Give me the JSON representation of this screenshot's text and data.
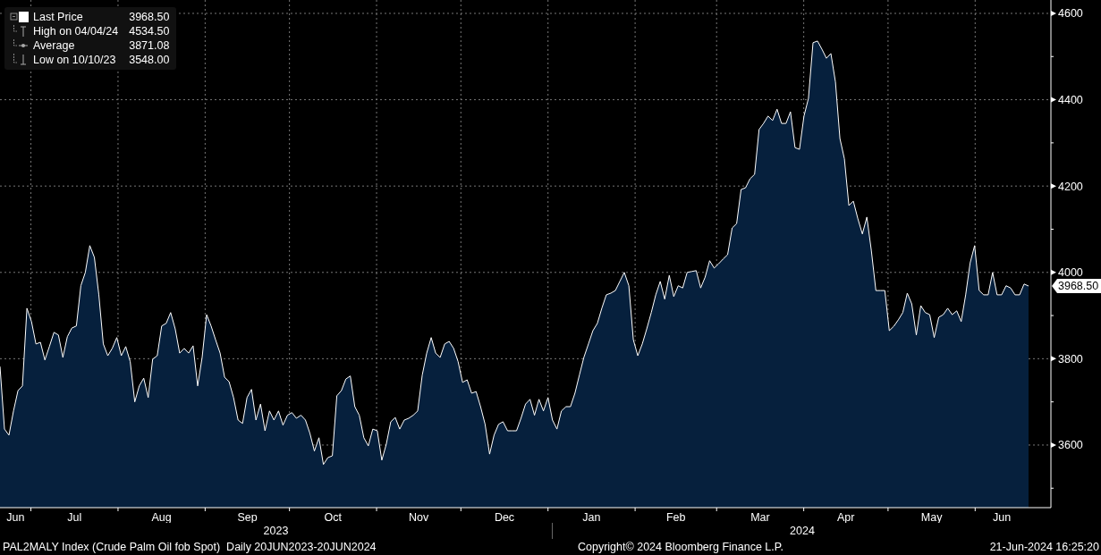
{
  "legend": {
    "items": [
      {
        "kind": "last",
        "label": "Last Price",
        "value": "3968.50"
      },
      {
        "kind": "high",
        "label": "High on 04/04/24",
        "value": "4534.50"
      },
      {
        "kind": "average",
        "label": "Average",
        "value": "3871.08"
      },
      {
        "kind": "low",
        "label": "Low on 10/10/23",
        "value": "3548.00"
      }
    ]
  },
  "chart": {
    "month_labels": [
      "Jun",
      "Jul",
      "Aug",
      "Sep",
      "Oct",
      "Nov",
      "Dec",
      "Jan",
      "Feb",
      "Mar",
      "Apr",
      "May",
      "Jun"
    ],
    "chart_data": {
      "type": "area",
      "grid": true,
      "ylim": [
        3455,
        4631
      ],
      "yticks": [
        3600,
        3800,
        4000,
        4200,
        4400,
        4600
      ],
      "series": [
        {
          "color": "#ffffff",
          "values": [
            3782,
            3637,
            3623,
            3679,
            3726,
            3737,
            3917,
            3886,
            3834,
            3838,
            3797,
            3828,
            3861,
            3855,
            3803,
            3851,
            3871,
            3876,
            3969,
            4000,
            4062,
            4035,
            3948,
            3834,
            3807,
            3824,
            3849,
            3807,
            3828,
            3793,
            3700,
            3737,
            3755,
            3710,
            3799,
            3807,
            3876,
            3882,
            3907,
            3869,
            3813,
            3824,
            3813,
            3830,
            3737,
            3803,
            3902,
            3876,
            3844,
            3813,
            3757,
            3747,
            3710,
            3658,
            3650,
            3710,
            3729,
            3658,
            3695,
            3633,
            3679,
            3658,
            3679,
            3646,
            3669,
            3675,
            3662,
            3669,
            3658,
            3627,
            3586,
            3617,
            3555,
            3571,
            3575,
            3714,
            3726,
            3753,
            3760,
            3689,
            3669,
            3617,
            3598,
            3637,
            3633,
            3565,
            3602,
            3654,
            3664,
            3637,
            3658,
            3662,
            3669,
            3679,
            3762,
            3813,
            3849,
            3813,
            3803,
            3834,
            3840,
            3824,
            3793,
            3745,
            3751,
            3720,
            3724,
            3689,
            3648,
            3579,
            3623,
            3648,
            3654,
            3633,
            3633,
            3633,
            3662,
            3695,
            3706,
            3669,
            3706,
            3679,
            3710,
            3658,
            3637,
            3679,
            3689,
            3689,
            3720,
            3762,
            3803,
            3834,
            3865,
            3882,
            3917,
            3948,
            3952,
            3958,
            3979,
            4000,
            3969,
            3844,
            3807,
            3834,
            3869,
            3907,
            3948,
            3979,
            3938,
            3993,
            3944,
            3969,
            3964,
            4000,
            4002,
            4004,
            3964,
            3989,
            4027,
            4010,
            4020,
            4031,
            4041,
            4103,
            4113,
            4192,
            4196,
            4217,
            4227,
            4331,
            4345,
            4362,
            4352,
            4378,
            4345,
            4345,
            4372,
            4289,
            4285,
            4362,
            4403,
            4532,
            4536,
            4517,
            4496,
            4507,
            4441,
            4310,
            4263,
            4155,
            4165,
            4124,
            4089,
            4128,
            4051,
            3958,
            3958,
            3958,
            3865,
            3875,
            3890,
            3907,
            3952,
            3927,
            3855,
            3923,
            3907,
            3902,
            3849,
            3896,
            3902,
            3917,
            3902,
            3911,
            3886,
            3948,
            4022,
            4062,
            3958,
            3948,
            3948,
            4000,
            3948,
            3948,
            3969,
            3964,
            3948,
            3948,
            3973,
            3968.5
          ]
        }
      ]
    },
    "last_price_tag": "3968.50"
  },
  "year_labels": [
    "2023",
    "2024"
  ],
  "footer": {
    "security": "PAL2MALY Index (Crude Palm Oil fob Spot)  Daily 20JUN2023-20JUN2024",
    "copyright": "Copyright© 2024 Bloomberg Finance L.P.",
    "timestamp": "21-Jun-2024 16:25:20"
  }
}
